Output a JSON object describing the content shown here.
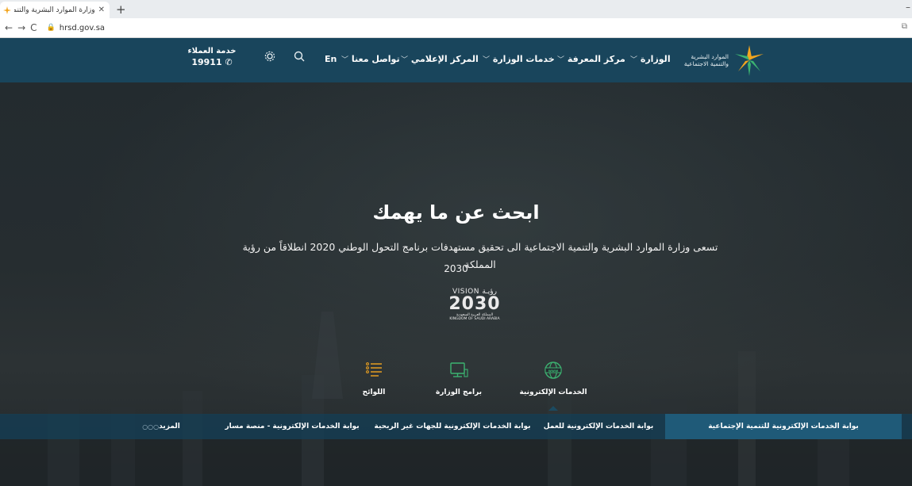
{
  "browser": {
    "tab_title": "وزارة الموارد البشرية والتنمية الاجتماعية",
    "tab_close": "✕",
    "new_tab": "+",
    "url": "hrsd.gov.sa"
  },
  "header": {
    "logo_line1": "الموارد البشرية",
    "logo_line2": "والتنمية الاجتماعية",
    "nav": [
      {
        "label": "الوزارة"
      },
      {
        "label": "مركز المعرفة"
      },
      {
        "label": "خدمات الوزارة"
      },
      {
        "label": "المركز الإعلامي"
      },
      {
        "label": "تواصل معنا"
      }
    ],
    "lang": "En",
    "customer_service_label": "خدمة العملاء",
    "customer_service_number": "19911"
  },
  "hero": {
    "title": "ابحث عن ما يهمك",
    "subtitle": "تسعى وزارة الموارد البشرية والتنمية الاجتماعية الى تحقيق مستهدفات برنامج التحول الوطني 2020 انطلاقاً من رؤية المملكة",
    "subtitle_year": "2030",
    "vision_top": "VISION رؤيـة",
    "vision_big": "2030",
    "vision_footer_ar": "المملكة العربية السعودية",
    "vision_footer_en": "KINGDOM OF SAUDI ARABIA"
  },
  "categories": [
    {
      "label": "الخدمات الإلكترونية",
      "icon": "globe-www-icon",
      "active": true
    },
    {
      "label": "برامج الوزارة",
      "icon": "computer-icon",
      "active": false
    },
    {
      "label": "اللوائح",
      "icon": "list-icon",
      "active": false
    }
  ],
  "services": [
    {
      "label": "بوابة الخدمات الإلكترونية للتنمية الإجتماعية"
    },
    {
      "label": "بوابة الخدمات الإلكترونية للعمل"
    },
    {
      "label": "بوابة الخدمات الإلكترونية للجهات غير الربحية"
    },
    {
      "label": "بوابة الخدمات الإلكترونية - منصة مسار"
    },
    {
      "label": "المزيد"
    }
  ],
  "colors": {
    "header_bg": "#19455c",
    "service_bar": "#163e54",
    "accent_orange": "#f2a51f",
    "accent_green": "#3cb371"
  }
}
